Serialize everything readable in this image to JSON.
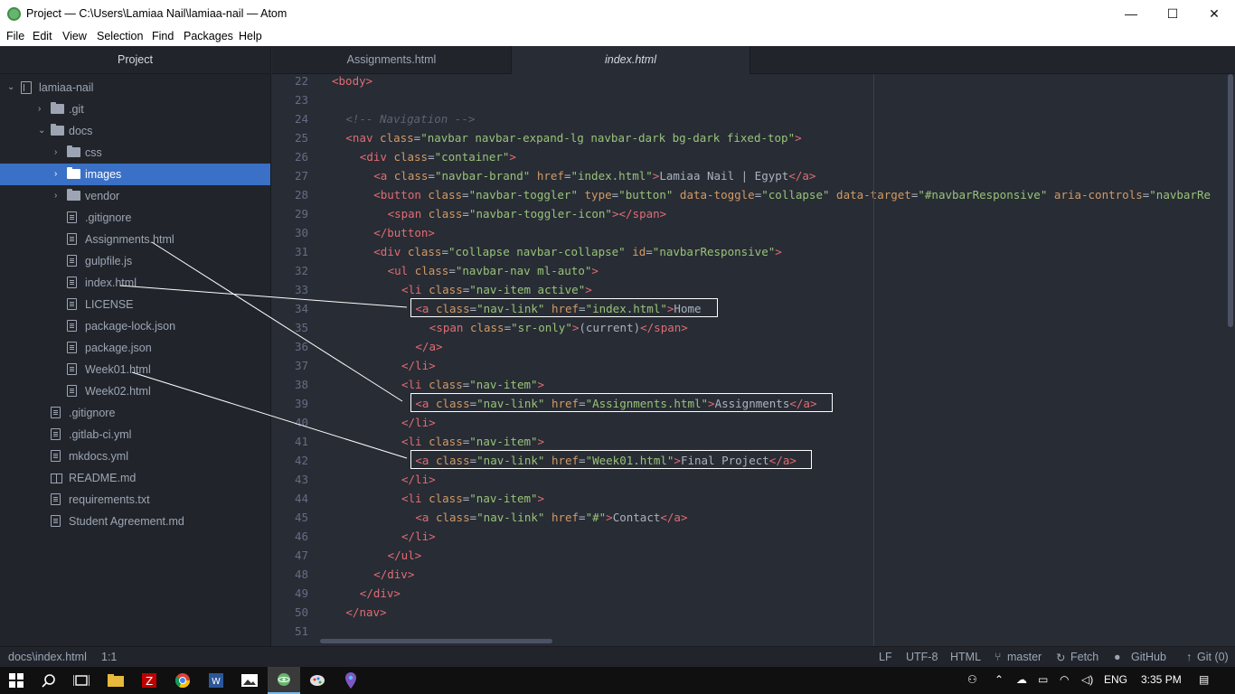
{
  "window": {
    "title": "Project — C:\\Users\\Lamiaa Nail\\lamiaa-nail — Atom",
    "minimize": "—",
    "maximize": "☐",
    "close": "✕"
  },
  "menu": [
    "File",
    "Edit",
    "View",
    "Selection",
    "Find",
    "Packages",
    "Help"
  ],
  "sidebar": {
    "title": "Project",
    "items": [
      {
        "label": "lamiaa-nail",
        "icon": "repo-icon",
        "type": "root",
        "expanded": true
      },
      {
        "label": ".git",
        "icon": "folder-icon",
        "type": "folder",
        "expanded": false
      },
      {
        "label": "docs",
        "icon": "folder-icon",
        "type": "folder",
        "expanded": true
      },
      {
        "label": "css",
        "icon": "folder-icon",
        "type": "folder",
        "expanded": false
      },
      {
        "label": "images",
        "icon": "folder-icon",
        "type": "folder",
        "expanded": false,
        "selected": true
      },
      {
        "label": "vendor",
        "icon": "folder-icon",
        "type": "folder",
        "expanded": false
      },
      {
        "label": ".gitignore",
        "icon": "file-icon",
        "type": "file"
      },
      {
        "label": "Assignments.html",
        "icon": "file-icon",
        "type": "file"
      },
      {
        "label": "gulpfile.js",
        "icon": "file-icon",
        "type": "file"
      },
      {
        "label": "index.html",
        "icon": "file-icon",
        "type": "file"
      },
      {
        "label": "LICENSE",
        "icon": "file-icon",
        "type": "file"
      },
      {
        "label": "package-lock.json",
        "icon": "file-icon",
        "type": "file"
      },
      {
        "label": "package.json",
        "icon": "file-icon",
        "type": "file"
      },
      {
        "label": "Week01.html",
        "icon": "file-icon",
        "type": "file"
      },
      {
        "label": "Week02.html",
        "icon": "file-icon",
        "type": "file"
      },
      {
        "label": ".gitignore",
        "icon": "file-icon",
        "type": "file"
      },
      {
        "label": ".gitlab-ci.yml",
        "icon": "file-icon",
        "type": "file"
      },
      {
        "label": "mkdocs.yml",
        "icon": "file-icon",
        "type": "file"
      },
      {
        "label": "README.md",
        "icon": "book-icon",
        "type": "file"
      },
      {
        "label": "requirements.txt",
        "icon": "file-icon",
        "type": "file"
      },
      {
        "label": "Student Agreement.md",
        "icon": "file-icon",
        "type": "file"
      }
    ]
  },
  "tabs": [
    {
      "label": "Assignments.html",
      "active": false
    },
    {
      "label": "index.html",
      "active": true
    }
  ],
  "editor": {
    "line_numbers": [
      "22",
      "23",
      "24",
      "25",
      "26",
      "27",
      "28",
      "29",
      "30",
      "31",
      "32",
      "33",
      "34",
      "35",
      "36",
      "37",
      "38",
      "39",
      "40",
      "41",
      "42",
      "43",
      "44",
      "45",
      "46",
      "47",
      "48",
      "49",
      "50",
      "51"
    ],
    "lines": [
      [
        [
          "t",
          "<body>"
        ]
      ],
      [],
      [
        [
          "c",
          "<!-- Navigation -->"
        ]
      ],
      [
        [
          "t",
          "<nav "
        ],
        [
          "a",
          "class"
        ],
        [
          "p",
          "="
        ],
        [
          "s",
          "\"navbar navbar-expand-lg navbar-dark bg-dark fixed-top\""
        ],
        [
          "t",
          ">"
        ]
      ],
      [
        [
          "t",
          "<div "
        ],
        [
          "a",
          "class"
        ],
        [
          "p",
          "="
        ],
        [
          "s",
          "\"container\""
        ],
        [
          "t",
          ">"
        ]
      ],
      [
        [
          "t",
          "<a "
        ],
        [
          "a",
          "class"
        ],
        [
          "p",
          "="
        ],
        [
          "s",
          "\"navbar-brand\""
        ],
        [
          "p",
          " "
        ],
        [
          "a",
          "href"
        ],
        [
          "p",
          "="
        ],
        [
          "s",
          "\"index.html\""
        ],
        [
          "t",
          ">"
        ],
        [
          "p",
          "Lamiaa Nail | Egypt"
        ],
        [
          "t",
          "</a>"
        ]
      ],
      [
        [
          "t",
          "<button "
        ],
        [
          "a",
          "class"
        ],
        [
          "p",
          "="
        ],
        [
          "s",
          "\"navbar-toggler\""
        ],
        [
          "p",
          " "
        ],
        [
          "a",
          "type"
        ],
        [
          "p",
          "="
        ],
        [
          "s",
          "\"button\""
        ],
        [
          "p",
          " "
        ],
        [
          "a",
          "data-toggle"
        ],
        [
          "p",
          "="
        ],
        [
          "s",
          "\"collapse\""
        ],
        [
          "p",
          " "
        ],
        [
          "a",
          "data-target"
        ],
        [
          "p",
          "="
        ],
        [
          "s",
          "\"#navbarResponsive\""
        ],
        [
          "p",
          " "
        ],
        [
          "a",
          "aria-controls"
        ],
        [
          "p",
          "="
        ],
        [
          "s",
          "\"navbarRe"
        ]
      ],
      [
        [
          "t",
          "<span "
        ],
        [
          "a",
          "class"
        ],
        [
          "p",
          "="
        ],
        [
          "s",
          "\"navbar-toggler-icon\""
        ],
        [
          "t",
          "></span>"
        ]
      ],
      [
        [
          "t",
          "</button>"
        ]
      ],
      [
        [
          "t",
          "<div "
        ],
        [
          "a",
          "class"
        ],
        [
          "p",
          "="
        ],
        [
          "s",
          "\"collapse navbar-collapse\""
        ],
        [
          "p",
          " "
        ],
        [
          "a",
          "id"
        ],
        [
          "p",
          "="
        ],
        [
          "s",
          "\"navbarResponsive\""
        ],
        [
          "t",
          ">"
        ]
      ],
      [
        [
          "t",
          "<ul "
        ],
        [
          "a",
          "class"
        ],
        [
          "p",
          "="
        ],
        [
          "s",
          "\"navbar-nav ml-auto\""
        ],
        [
          "t",
          ">"
        ]
      ],
      [
        [
          "t",
          "<li "
        ],
        [
          "a",
          "class"
        ],
        [
          "p",
          "="
        ],
        [
          "s",
          "\"nav-item active\""
        ],
        [
          "t",
          ">"
        ]
      ],
      [
        [
          "t",
          "<a "
        ],
        [
          "a",
          "class"
        ],
        [
          "p",
          "="
        ],
        [
          "s",
          "\"nav-link\""
        ],
        [
          "p",
          " "
        ],
        [
          "a",
          "href"
        ],
        [
          "p",
          "="
        ],
        [
          "s",
          "\"index.html\""
        ],
        [
          "t",
          ">"
        ],
        [
          "p",
          "Home"
        ]
      ],
      [
        [
          "t",
          "<span "
        ],
        [
          "a",
          "class"
        ],
        [
          "p",
          "="
        ],
        [
          "s",
          "\"sr-only\""
        ],
        [
          "t",
          ">"
        ],
        [
          "p",
          "(current)"
        ],
        [
          "t",
          "</span>"
        ]
      ],
      [
        [
          "t",
          "</a>"
        ]
      ],
      [
        [
          "t",
          "</li>"
        ]
      ],
      [
        [
          "t",
          "<li "
        ],
        [
          "a",
          "class"
        ],
        [
          "p",
          "="
        ],
        [
          "s",
          "\"nav-item\""
        ],
        [
          "t",
          ">"
        ]
      ],
      [
        [
          "t",
          "<a "
        ],
        [
          "a",
          "class"
        ],
        [
          "p",
          "="
        ],
        [
          "s",
          "\"nav-link\""
        ],
        [
          "p",
          " "
        ],
        [
          "a",
          "href"
        ],
        [
          "p",
          "="
        ],
        [
          "s",
          "\"Assignments.html\""
        ],
        [
          "t",
          ">"
        ],
        [
          "p",
          "Assignments"
        ],
        [
          "t",
          "</a>"
        ]
      ],
      [
        [
          "t",
          "</li>"
        ]
      ],
      [
        [
          "t",
          "<li "
        ],
        [
          "a",
          "class"
        ],
        [
          "p",
          "="
        ],
        [
          "s",
          "\"nav-item\""
        ],
        [
          "t",
          ">"
        ]
      ],
      [
        [
          "t",
          "<a "
        ],
        [
          "a",
          "class"
        ],
        [
          "p",
          "="
        ],
        [
          "s",
          "\"nav-link\""
        ],
        [
          "p",
          " "
        ],
        [
          "a",
          "href"
        ],
        [
          "p",
          "="
        ],
        [
          "s",
          "\"Week01.html\""
        ],
        [
          "t",
          ">"
        ],
        [
          "p",
          "Final Project"
        ],
        [
          "t",
          "</a>"
        ]
      ],
      [
        [
          "t",
          "</li>"
        ]
      ],
      [
        [
          "t",
          "<li "
        ],
        [
          "a",
          "class"
        ],
        [
          "p",
          "="
        ],
        [
          "s",
          "\"nav-item\""
        ],
        [
          "t",
          ">"
        ]
      ],
      [
        [
          "t",
          "<a "
        ],
        [
          "a",
          "class"
        ],
        [
          "p",
          "="
        ],
        [
          "s",
          "\"nav-link\""
        ],
        [
          "p",
          " "
        ],
        [
          "a",
          "href"
        ],
        [
          "p",
          "="
        ],
        [
          "s",
          "\"#\""
        ],
        [
          "t",
          ">"
        ],
        [
          "p",
          "Contact"
        ],
        [
          "t",
          "</a>"
        ]
      ],
      [
        [
          "t",
          "</li>"
        ]
      ],
      [
        [
          "t",
          "</ul>"
        ]
      ],
      [
        [
          "t",
          "</div>"
        ]
      ],
      [
        [
          "t",
          "</div>"
        ]
      ],
      [
        [
          "t",
          "</nav>"
        ]
      ],
      []
    ]
  },
  "statusbar": {
    "path": "docs\\index.html",
    "cursor": "1:1",
    "line_ending": "LF",
    "encoding": "UTF-8",
    "grammar": "HTML",
    "branch": "master",
    "fetch": "Fetch",
    "github": "GitHub",
    "git": "Git (0)"
  },
  "taskbar": {
    "apps": [
      "windows-start-icon",
      "search-icon",
      "task-view-icon",
      "file-explorer-icon",
      "filezilla-icon",
      "chrome-icon",
      "word-icon",
      "photos-icon",
      "atom-icon",
      "paint-icon",
      "maps-icon"
    ],
    "language": "ENG",
    "time": "3:35 PM"
  }
}
